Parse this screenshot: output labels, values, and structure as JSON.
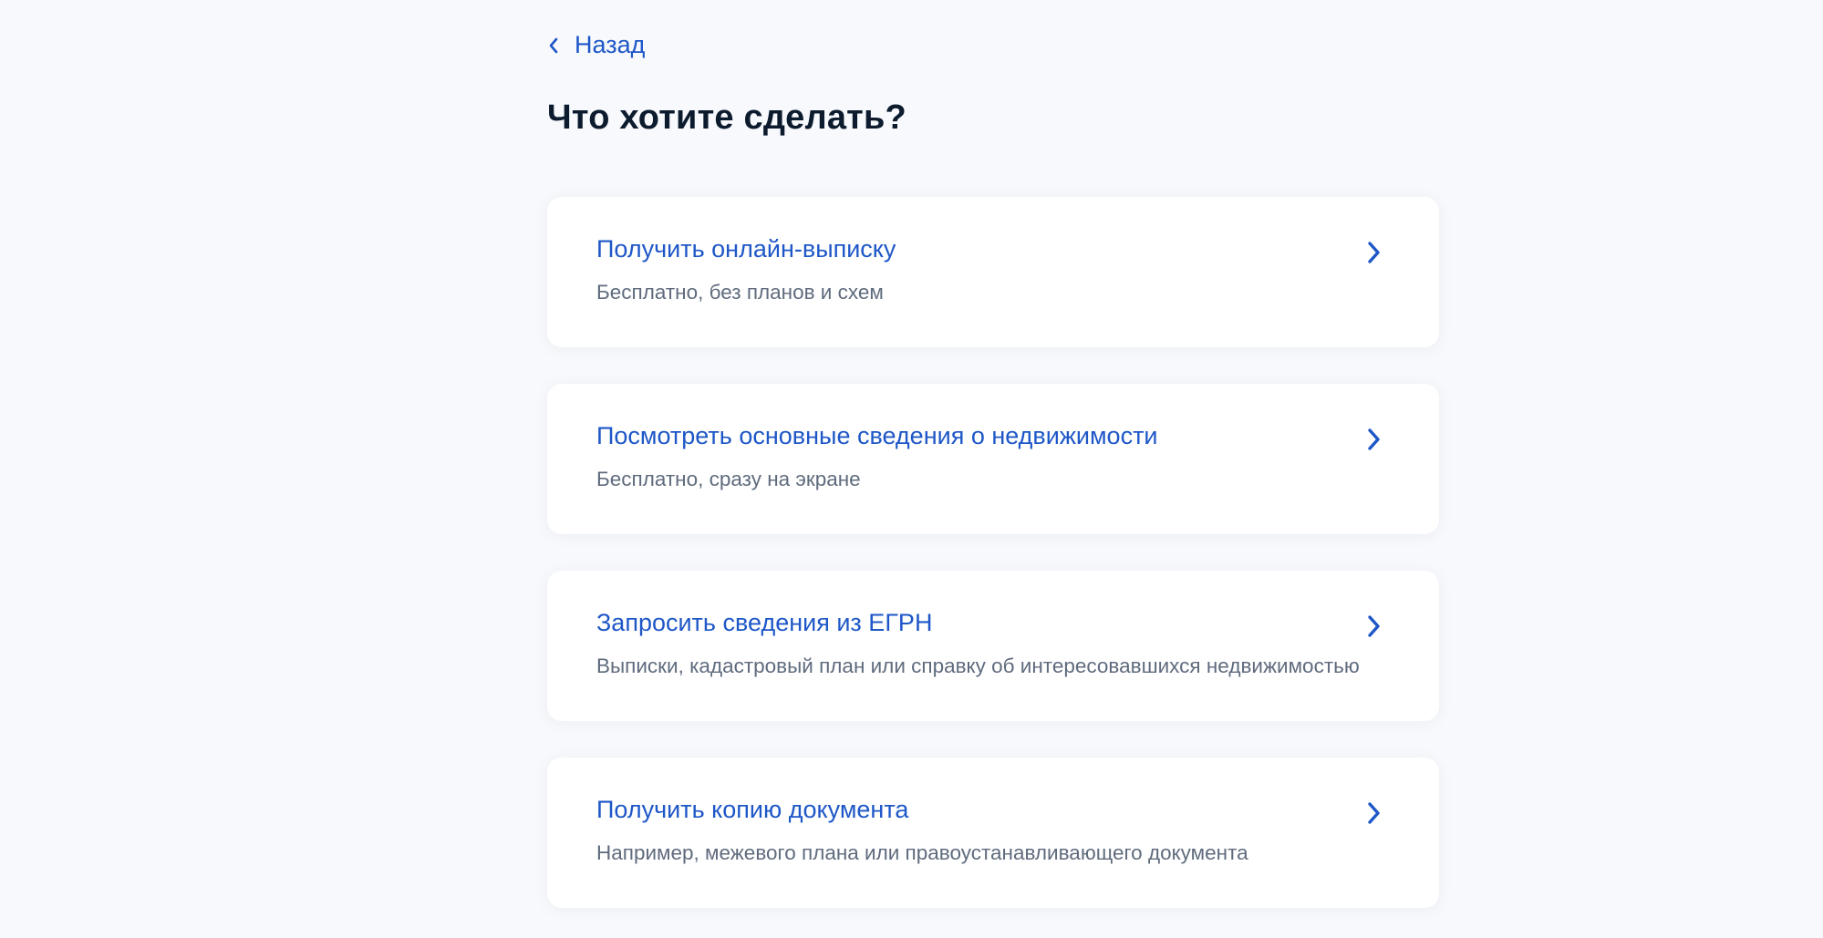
{
  "nav": {
    "back_label": "Назад",
    "back_icon": "chevron-left-icon"
  },
  "page": {
    "title": "Что хотите сделать?"
  },
  "options": [
    {
      "title": "Получить онлайн-выписку",
      "subtitle": "Бесплатно, без планов и схем",
      "icon": "chevron-right-icon"
    },
    {
      "title": "Посмотреть основные сведения о недвижимости",
      "subtitle": "Бесплатно, сразу на экране",
      "icon": "chevron-right-icon"
    },
    {
      "title": "Запросить сведения из ЕГРН",
      "subtitle": "Выписки, кадастровый план или справку об интересовавшихся недвижимостью",
      "icon": "chevron-right-icon"
    },
    {
      "title": "Получить копию документа",
      "subtitle": "Например, межевого плана или правоустанавливающего документа",
      "icon": "chevron-right-icon"
    }
  ],
  "colors": {
    "accent": "#1e57c7",
    "heading": "#0d1b2e",
    "muted": "#5f6b7d",
    "background": "#f7f9fc",
    "card": "#ffffff"
  }
}
